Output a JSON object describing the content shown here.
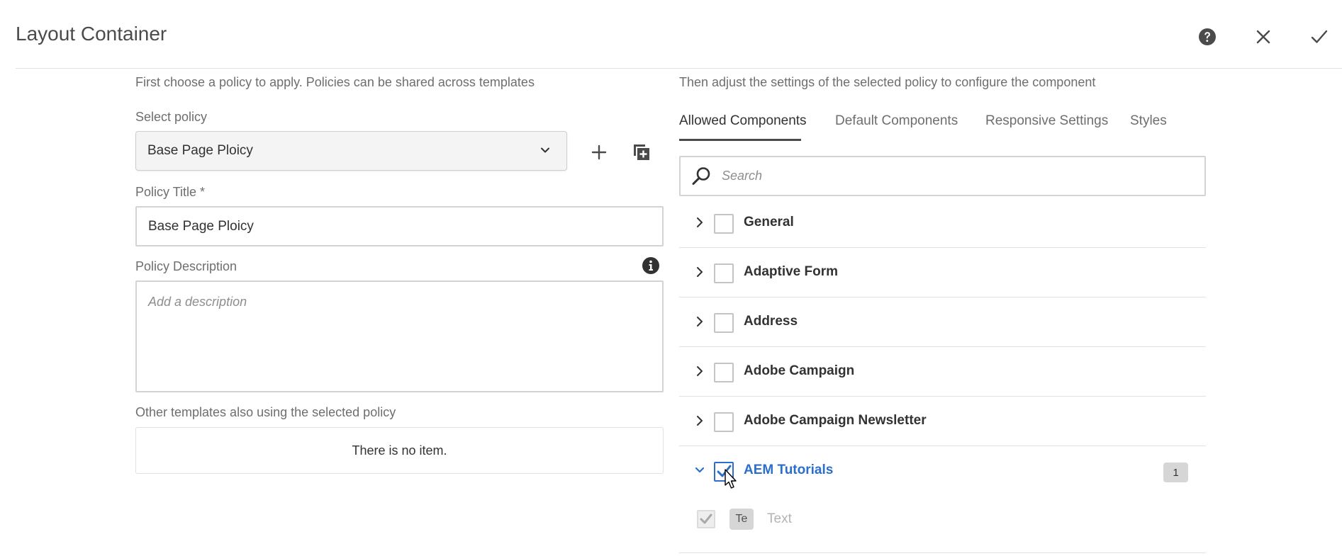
{
  "header": {
    "title": "Layout Container",
    "help_icon": "help-circle-icon",
    "close_icon": "close-icon",
    "done_icon": "checkmark-icon"
  },
  "left": {
    "intro": "First choose a policy to apply. Policies can be shared across templates",
    "select_policy_label": "Select policy",
    "select_policy_value": "Base Page Ploicy",
    "policy_title_label": "Policy Title *",
    "policy_title_value": "Base Page Ploicy",
    "policy_description_label": "Policy Description",
    "policy_description_placeholder": "Add a description",
    "other_templates_label": "Other templates also using the selected policy",
    "empty_message": "There is no item."
  },
  "right": {
    "intro": "Then adjust the settings of the selected policy to configure the component",
    "tabs": [
      {
        "label": "Allowed Components",
        "active": true
      },
      {
        "label": "Default Components",
        "active": false
      },
      {
        "label": "Responsive Settings",
        "active": false
      },
      {
        "label": "Styles",
        "active": false
      }
    ],
    "search_placeholder": "Search",
    "groups": [
      {
        "label": "General",
        "checked": false,
        "expanded": false
      },
      {
        "label": "Adaptive Form",
        "checked": false,
        "expanded": false
      },
      {
        "label": "Address",
        "checked": false,
        "expanded": false
      },
      {
        "label": "Adobe Campaign",
        "checked": false,
        "expanded": false
      },
      {
        "label": "Adobe Campaign Newsletter",
        "checked": false,
        "expanded": false
      },
      {
        "label": "AEM Tutorials",
        "checked": true,
        "expanded": true,
        "count": "1"
      }
    ],
    "children": [
      {
        "abbr": "Te",
        "label": "Text",
        "checked": true,
        "disabled": true
      }
    ]
  },
  "colors": {
    "accent": "#2c6ecb",
    "text": "#323232",
    "muted": "#6e6e6e",
    "border": "#d3d3d3"
  }
}
